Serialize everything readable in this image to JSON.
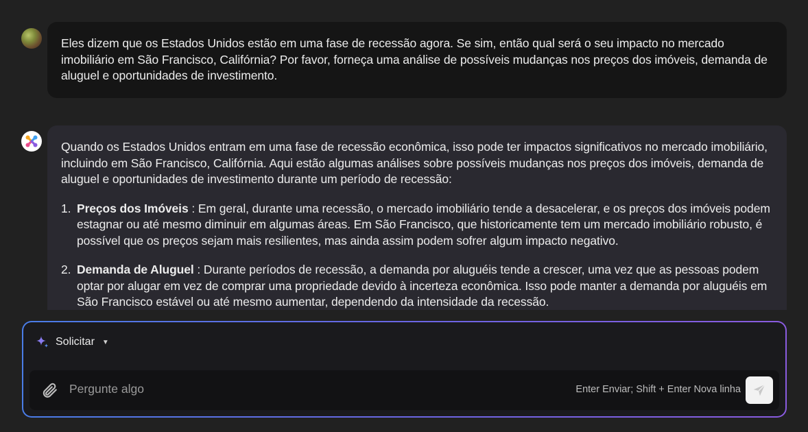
{
  "conversation": {
    "user_message": "Eles dizem que os Estados Unidos estão em uma fase de recessão agora. Se sim, então qual será o seu impacto no mercado imobiliário em São Francisco, Califórnia? Por favor, forneça uma análise de possíveis mudanças nos preços dos imóveis, demanda de aluguel e oportunidades de investimento.",
    "assistant_intro": "Quando os Estados Unidos entram em uma fase de recessão econômica, isso pode ter impactos significativos no mercado imobiliário, incluindo em São Francisco, Califórnia. Aqui estão algumas análises sobre possíveis mudanças nos preços dos imóveis, demanda de aluguel e oportunidades de investimento durante um período de recessão:",
    "assistant_items": [
      {
        "number": "1.",
        "title": "Preços dos Imóveis",
        "text": " : Em geral, durante uma recessão, o mercado imobiliário tende a desacelerar, e os preços dos imóveis podem estagnar ou até mesmo diminuir em algumas áreas. Em São Francisco, que historicamente tem um mercado imobiliário robusto, é possível que os preços sejam mais resilientes, mas ainda assim podem sofrer algum impacto negativo."
      },
      {
        "number": "2.",
        "title": "Demanda de Aluguel",
        "text": " : Durante períodos de recessão, a demanda por aluguéis tende a crescer, uma vez que as pessoas podem optar por alugar em vez de comprar uma propriedade devido à incerteza econômica. Isso pode manter a demanda por aluguéis em São Francisco estável ou até mesmo aumentar, dependendo da intensidade da recessão."
      }
    ]
  },
  "composer": {
    "mode_label": "Solicitar",
    "mode_icon": "sparkle-icon",
    "input_placeholder": "Pergunte algo",
    "input_value": "",
    "hint": "Enter Enviar; Shift + Enter Nova linha",
    "attach_icon": "paperclip-icon",
    "send_icon": "paper-plane-icon"
  },
  "colors": {
    "background": "#212121",
    "user_bubble": "#151515",
    "assistant_bubble": "#2a2930",
    "composer_border_start": "#4a7de8",
    "composer_border_end": "#8a5be0"
  }
}
